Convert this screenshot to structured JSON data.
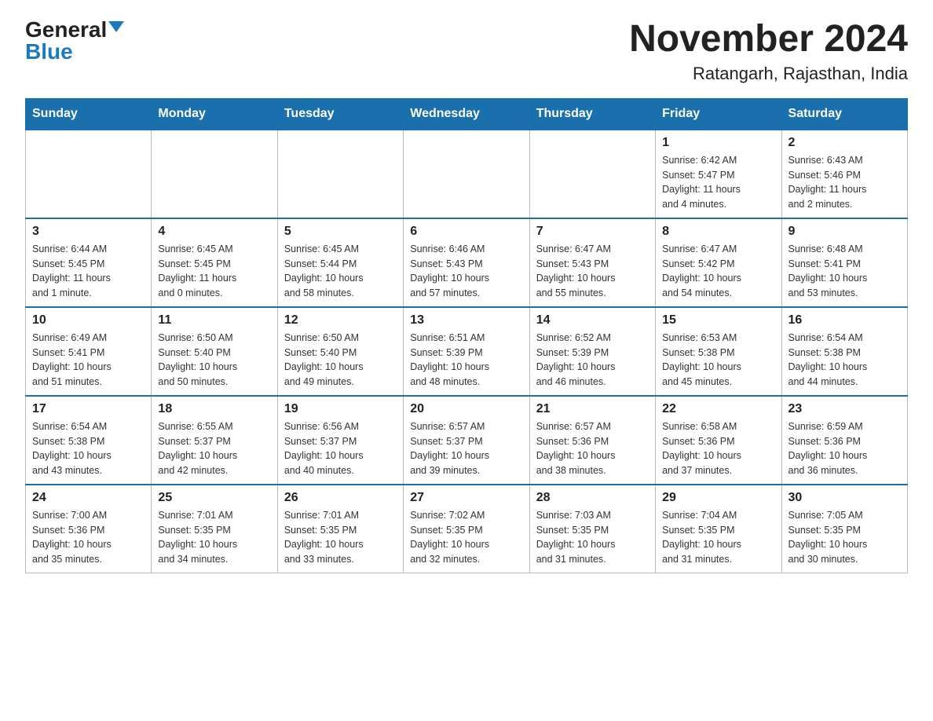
{
  "header": {
    "logo_general": "General",
    "logo_blue": "Blue",
    "month": "November 2024",
    "location": "Ratangarh, Rajasthan, India"
  },
  "weekdays": [
    "Sunday",
    "Monday",
    "Tuesday",
    "Wednesday",
    "Thursday",
    "Friday",
    "Saturday"
  ],
  "weeks": [
    [
      {
        "day": "",
        "info": ""
      },
      {
        "day": "",
        "info": ""
      },
      {
        "day": "",
        "info": ""
      },
      {
        "day": "",
        "info": ""
      },
      {
        "day": "",
        "info": ""
      },
      {
        "day": "1",
        "info": "Sunrise: 6:42 AM\nSunset: 5:47 PM\nDaylight: 11 hours\nand 4 minutes."
      },
      {
        "day": "2",
        "info": "Sunrise: 6:43 AM\nSunset: 5:46 PM\nDaylight: 11 hours\nand 2 minutes."
      }
    ],
    [
      {
        "day": "3",
        "info": "Sunrise: 6:44 AM\nSunset: 5:45 PM\nDaylight: 11 hours\nand 1 minute."
      },
      {
        "day": "4",
        "info": "Sunrise: 6:45 AM\nSunset: 5:45 PM\nDaylight: 11 hours\nand 0 minutes."
      },
      {
        "day": "5",
        "info": "Sunrise: 6:45 AM\nSunset: 5:44 PM\nDaylight: 10 hours\nand 58 minutes."
      },
      {
        "day": "6",
        "info": "Sunrise: 6:46 AM\nSunset: 5:43 PM\nDaylight: 10 hours\nand 57 minutes."
      },
      {
        "day": "7",
        "info": "Sunrise: 6:47 AM\nSunset: 5:43 PM\nDaylight: 10 hours\nand 55 minutes."
      },
      {
        "day": "8",
        "info": "Sunrise: 6:47 AM\nSunset: 5:42 PM\nDaylight: 10 hours\nand 54 minutes."
      },
      {
        "day": "9",
        "info": "Sunrise: 6:48 AM\nSunset: 5:41 PM\nDaylight: 10 hours\nand 53 minutes."
      }
    ],
    [
      {
        "day": "10",
        "info": "Sunrise: 6:49 AM\nSunset: 5:41 PM\nDaylight: 10 hours\nand 51 minutes."
      },
      {
        "day": "11",
        "info": "Sunrise: 6:50 AM\nSunset: 5:40 PM\nDaylight: 10 hours\nand 50 minutes."
      },
      {
        "day": "12",
        "info": "Sunrise: 6:50 AM\nSunset: 5:40 PM\nDaylight: 10 hours\nand 49 minutes."
      },
      {
        "day": "13",
        "info": "Sunrise: 6:51 AM\nSunset: 5:39 PM\nDaylight: 10 hours\nand 48 minutes."
      },
      {
        "day": "14",
        "info": "Sunrise: 6:52 AM\nSunset: 5:39 PM\nDaylight: 10 hours\nand 46 minutes."
      },
      {
        "day": "15",
        "info": "Sunrise: 6:53 AM\nSunset: 5:38 PM\nDaylight: 10 hours\nand 45 minutes."
      },
      {
        "day": "16",
        "info": "Sunrise: 6:54 AM\nSunset: 5:38 PM\nDaylight: 10 hours\nand 44 minutes."
      }
    ],
    [
      {
        "day": "17",
        "info": "Sunrise: 6:54 AM\nSunset: 5:38 PM\nDaylight: 10 hours\nand 43 minutes."
      },
      {
        "day": "18",
        "info": "Sunrise: 6:55 AM\nSunset: 5:37 PM\nDaylight: 10 hours\nand 42 minutes."
      },
      {
        "day": "19",
        "info": "Sunrise: 6:56 AM\nSunset: 5:37 PM\nDaylight: 10 hours\nand 40 minutes."
      },
      {
        "day": "20",
        "info": "Sunrise: 6:57 AM\nSunset: 5:37 PM\nDaylight: 10 hours\nand 39 minutes."
      },
      {
        "day": "21",
        "info": "Sunrise: 6:57 AM\nSunset: 5:36 PM\nDaylight: 10 hours\nand 38 minutes."
      },
      {
        "day": "22",
        "info": "Sunrise: 6:58 AM\nSunset: 5:36 PM\nDaylight: 10 hours\nand 37 minutes."
      },
      {
        "day": "23",
        "info": "Sunrise: 6:59 AM\nSunset: 5:36 PM\nDaylight: 10 hours\nand 36 minutes."
      }
    ],
    [
      {
        "day": "24",
        "info": "Sunrise: 7:00 AM\nSunset: 5:36 PM\nDaylight: 10 hours\nand 35 minutes."
      },
      {
        "day": "25",
        "info": "Sunrise: 7:01 AM\nSunset: 5:35 PM\nDaylight: 10 hours\nand 34 minutes."
      },
      {
        "day": "26",
        "info": "Sunrise: 7:01 AM\nSunset: 5:35 PM\nDaylight: 10 hours\nand 33 minutes."
      },
      {
        "day": "27",
        "info": "Sunrise: 7:02 AM\nSunset: 5:35 PM\nDaylight: 10 hours\nand 32 minutes."
      },
      {
        "day": "28",
        "info": "Sunrise: 7:03 AM\nSunset: 5:35 PM\nDaylight: 10 hours\nand 31 minutes."
      },
      {
        "day": "29",
        "info": "Sunrise: 7:04 AM\nSunset: 5:35 PM\nDaylight: 10 hours\nand 31 minutes."
      },
      {
        "day": "30",
        "info": "Sunrise: 7:05 AM\nSunset: 5:35 PM\nDaylight: 10 hours\nand 30 minutes."
      }
    ]
  ]
}
